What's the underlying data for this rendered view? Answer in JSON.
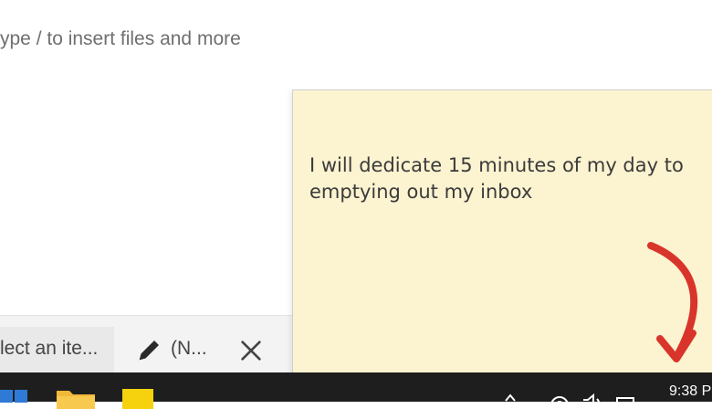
{
  "document": {
    "hint": "ype / to insert files and more"
  },
  "tabs": {
    "inactive_label": "lect an ite...",
    "active_label": "(N...",
    "active_icon": "pencil-icon",
    "close_icon": "close-icon"
  },
  "sticky_note": {
    "text": "I will dedicate 15 minutes of my day to emptying out my inbox",
    "background": "#fcf3d0",
    "annotation_color": "#d9342b"
  },
  "taskbar": {
    "icons": [
      "windows-start-icon",
      "file-explorer-icon",
      "sticky-notes-icon"
    ],
    "tray_icons": [
      "chevron-up-icon",
      "wifi-icon",
      "volume-icon",
      "battery-icon"
    ],
    "clock": "9:38 P"
  }
}
